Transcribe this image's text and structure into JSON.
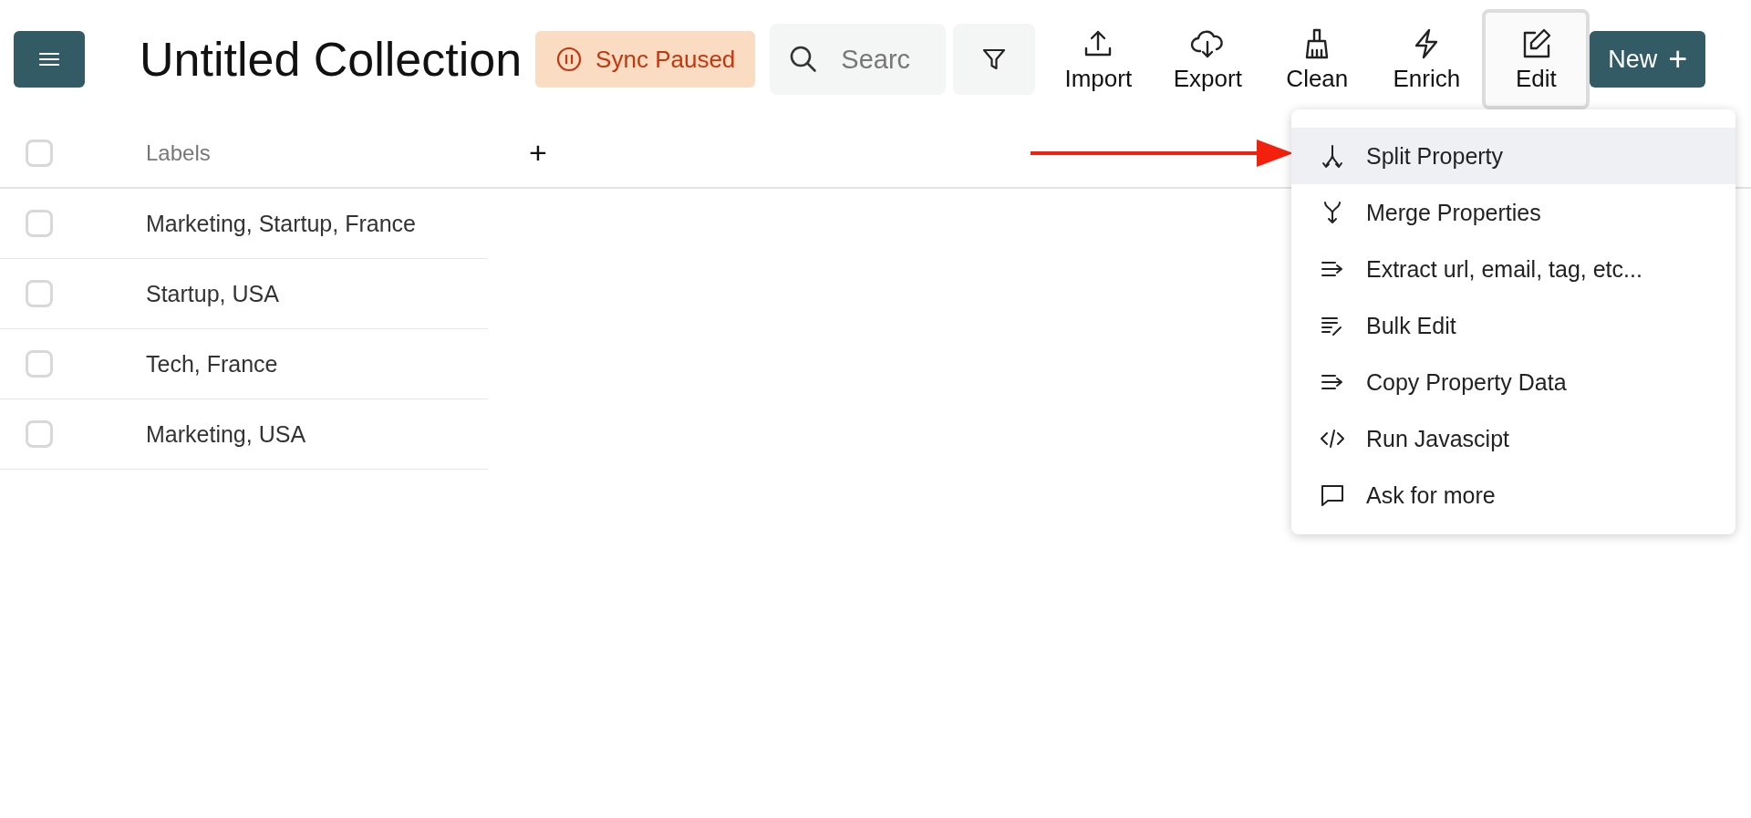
{
  "header": {
    "title": "Untitled Collection",
    "sync_badge": "Sync Paused",
    "search": {
      "placeholder": "Searc"
    },
    "tools": [
      {
        "kind": "import",
        "label": "Import",
        "selected": false
      },
      {
        "kind": "export",
        "label": "Export",
        "selected": false
      },
      {
        "kind": "clean",
        "label": "Clean",
        "selected": false
      },
      {
        "kind": "enrich",
        "label": "Enrich",
        "selected": false
      },
      {
        "kind": "edit",
        "label": "Edit",
        "selected": true
      }
    ],
    "new_button": "New",
    "new_icon": "+"
  },
  "table": {
    "select_all_checked": false,
    "columns": [
      {
        "label": "Labels"
      }
    ],
    "add_column": "+",
    "rows": [
      {
        "labels": "Marketing, Startup, France",
        "checked": false
      },
      {
        "labels": "Startup, USA",
        "checked": false
      },
      {
        "labels": "Tech, France",
        "checked": false
      },
      {
        "labels": "Marketing, USA",
        "checked": false
      }
    ]
  },
  "edit_menu": {
    "items": [
      {
        "kind": "split",
        "label": "Split Property",
        "selected": true
      },
      {
        "kind": "merge",
        "label": "Merge Properties",
        "selected": false
      },
      {
        "kind": "extract",
        "label": "Extract url, email, tag, etc...",
        "selected": false
      },
      {
        "kind": "bulk",
        "label": "Bulk Edit",
        "selected": false
      },
      {
        "kind": "copy",
        "label": "Copy Property Data",
        "selected": false
      },
      {
        "kind": "code",
        "label": "Run Javascipt",
        "selected": false
      },
      {
        "kind": "chat",
        "label": "Ask for more",
        "selected": false
      }
    ]
  }
}
